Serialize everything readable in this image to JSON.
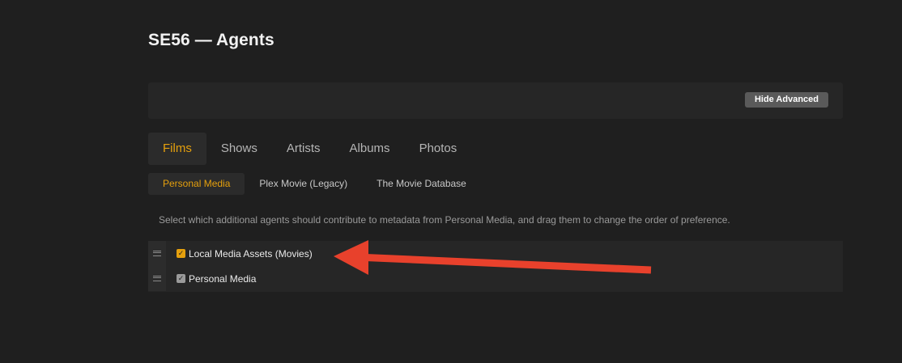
{
  "page": {
    "title": "SE56 — Agents"
  },
  "toolbar": {
    "hide_advanced_label": "Hide Advanced"
  },
  "type_tabs": [
    {
      "label": "Films",
      "active": true
    },
    {
      "label": "Shows",
      "active": false
    },
    {
      "label": "Artists",
      "active": false
    },
    {
      "label": "Albums",
      "active": false
    },
    {
      "label": "Photos",
      "active": false
    }
  ],
  "agent_tabs": [
    {
      "label": "Personal Media",
      "active": true
    },
    {
      "label": "Plex Movie (Legacy)",
      "active": false
    },
    {
      "label": "The Movie Database",
      "active": false
    }
  ],
  "description": "Select which additional agents should contribute to metadata from Personal Media, and drag them to change the order of preference.",
  "agents": [
    {
      "label": "Local Media Assets (Movies)",
      "checked": true,
      "icon": "drag-handle-icon"
    },
    {
      "label": "Personal Media",
      "checked": true,
      "icon": "drag-handle-icon"
    }
  ],
  "colors": {
    "accent": "#e5a00d",
    "annotation_arrow": "#e8412c",
    "background": "#1f1f1f",
    "panel": "#262626"
  }
}
